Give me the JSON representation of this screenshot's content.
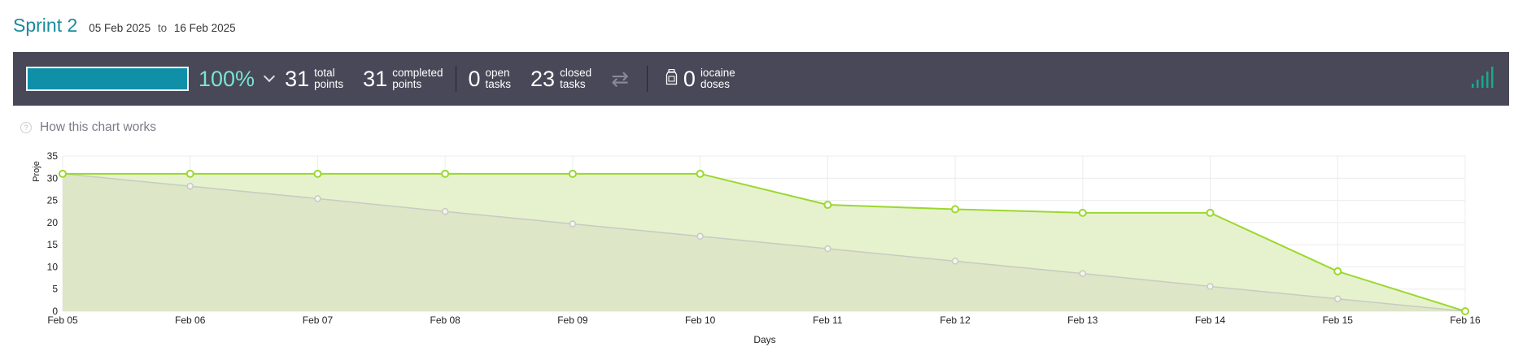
{
  "sprint": {
    "title": "Sprint 2",
    "start_date": "05 Feb 2025",
    "date_separator": "to",
    "end_date": "16 Feb 2025"
  },
  "summary": {
    "progress_percent_label": "100%",
    "progress_fraction": 1.0,
    "total_points": "31",
    "total_points_label_1": "total",
    "total_points_label_2": "points",
    "completed_points": "31",
    "completed_points_label_1": "completed",
    "completed_points_label_2": "points",
    "open_tasks": "0",
    "open_tasks_label_1": "open",
    "open_tasks_label_2": "tasks",
    "closed_tasks": "23",
    "closed_tasks_label_1": "closed",
    "closed_tasks_label_2": "tasks",
    "iocaine_doses": "0",
    "iocaine_label_1": "iocaine",
    "iocaine_label_2": "doses",
    "icons": {
      "toggle": "chevron-down-icon",
      "swap": "swap-arrows-icon",
      "iocaine": "iocaine-jar-icon",
      "graph": "bar-graph-icon"
    }
  },
  "help": {
    "text": "How this chart works",
    "icon": "question-icon"
  },
  "colors": {
    "accent": "#1a8a9e",
    "bar_bg": "#484858",
    "progress": "#0f8fa8",
    "percent": "#78e3d4",
    "actual_line": "#9bd82f",
    "ideal_line": "#c8cbc1"
  },
  "chart_data": {
    "type": "line",
    "xlabel": "Days",
    "ylabel": "Proje",
    "ylim": [
      0,
      35
    ],
    "yticks": [
      0,
      5,
      10,
      15,
      20,
      25,
      30,
      35
    ],
    "grid": true,
    "categories": [
      "Feb 05",
      "Feb 06",
      "Feb 07",
      "Feb 08",
      "Feb 09",
      "Feb 10",
      "Feb 11",
      "Feb 12",
      "Feb 13",
      "Feb 14",
      "Feb 15",
      "Feb 16"
    ],
    "series": [
      {
        "key": "actual",
        "values": [
          31,
          31,
          31,
          31,
          31,
          31,
          24,
          23,
          22.2,
          22.2,
          9,
          0
        ]
      },
      {
        "key": "ideal",
        "values": [
          31,
          28.2,
          25.4,
          22.5,
          19.7,
          16.9,
          14.1,
          11.3,
          8.5,
          5.6,
          2.8,
          0
        ]
      }
    ]
  }
}
